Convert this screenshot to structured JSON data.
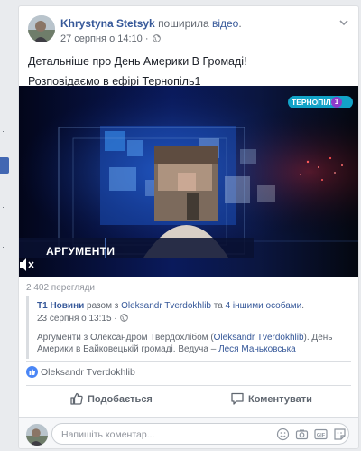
{
  "post": {
    "author": "Khrystyna Stetsyk",
    "action_prefix": "поширила ",
    "action_link": "відео",
    "action_suffix": ".",
    "timestamp": "27 серпня о 14:10 ·",
    "text_line1": "Детальніше про День Америки В Громаді!",
    "text_line2": "Розповідаємо в ефірі Тернопіль1"
  },
  "video": {
    "channel_name": "ТЕРНОПІЛЬ",
    "channel_number": "1",
    "show_title": "АРГУМЕНТИ",
    "mute_icon": "speaker-mute-icon"
  },
  "views": "2 402 перегляди",
  "shared": {
    "page": "Т1 Новини",
    "with_text": " разом з ",
    "person": "Oleksandr Tverdokhlib",
    "and_text": " та ",
    "others": "4 іншими особами",
    "end": ".",
    "timestamp": "23 серпня о 13:15 ·",
    "body_part1": "Аргументи з Олександром Твердохлібом (",
    "body_link1": "Oleksandr Tverdokhlib",
    "body_part2": "). День Америки в Байковецькій громаді. Ведуча – ",
    "body_link2": "Леся Маньковська"
  },
  "reactions": {
    "liker": "Oleksandr Tverdokhlib"
  },
  "actions": {
    "like_label": "Подобається",
    "comment_label": "Коментувати"
  },
  "comment_box": {
    "placeholder": "Напишіть коментар..."
  },
  "colors": {
    "link": "#365899",
    "like_blue": "#4a86f6",
    "channel_teal": "#12a3c8",
    "channel_purple": "#8d3cc9"
  }
}
